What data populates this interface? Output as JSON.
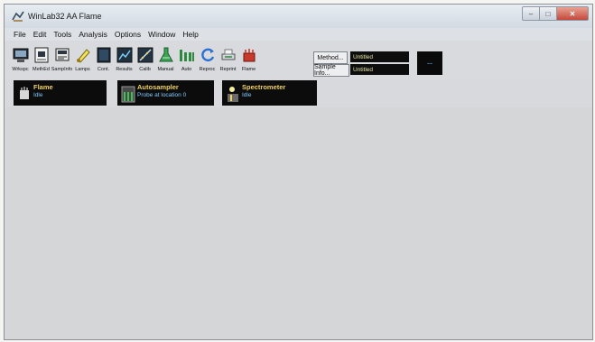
{
  "window": {
    "title": "WinLab32 AA Flame",
    "controls": {
      "minimize": "–",
      "maximize": "□",
      "close": "✕"
    }
  },
  "menu": [
    "File",
    "Edit",
    "Tools",
    "Analysis",
    "Options",
    "Window",
    "Help"
  ],
  "toolbar": {
    "items": [
      {
        "label": "Wrkspc",
        "icon": "workspace-icon"
      },
      {
        "label": "MethEd",
        "icon": "method-editor-icon"
      },
      {
        "label": "SampInfo",
        "icon": "sample-info-icon"
      },
      {
        "label": "Lamps",
        "icon": "lamps-icon"
      },
      {
        "label": "Cont.",
        "icon": "continuous-graphics-icon"
      },
      {
        "label": "Results",
        "icon": "results-icon"
      },
      {
        "label": "Calib",
        "icon": "calibration-icon"
      },
      {
        "label": "Manual",
        "icon": "manual-icon"
      },
      {
        "label": "Auto",
        "icon": "auto-icon"
      },
      {
        "label": "Reproc",
        "icon": "reprocess-icon"
      },
      {
        "label": "Reprint",
        "icon": "reprint-icon"
      },
      {
        "label": "Flame",
        "icon": "flame-icon"
      }
    ],
    "method_button": "Method...",
    "method_value": "Untitled",
    "sample_info_button": "Sample Info...",
    "sample_info_value": "Untitled",
    "status_box": "--"
  },
  "status_panels": [
    {
      "title": "Flame",
      "status": "Idle",
      "icon": "flame-status-icon"
    },
    {
      "title": "Autosampler",
      "status": "Probe at location 0",
      "icon": "autosampler-icon"
    },
    {
      "title": "Spectrometer",
      "status": "Idle",
      "icon": "spectrometer-icon"
    }
  ],
  "colors": {
    "panel_background": "#0c0c0c",
    "panel_title": "#f2d25c",
    "panel_status": "#7fc9ff",
    "field_background": "#0d0d0d",
    "field_text": "#e8e6a4",
    "workspace": "#d4d6d8"
  }
}
